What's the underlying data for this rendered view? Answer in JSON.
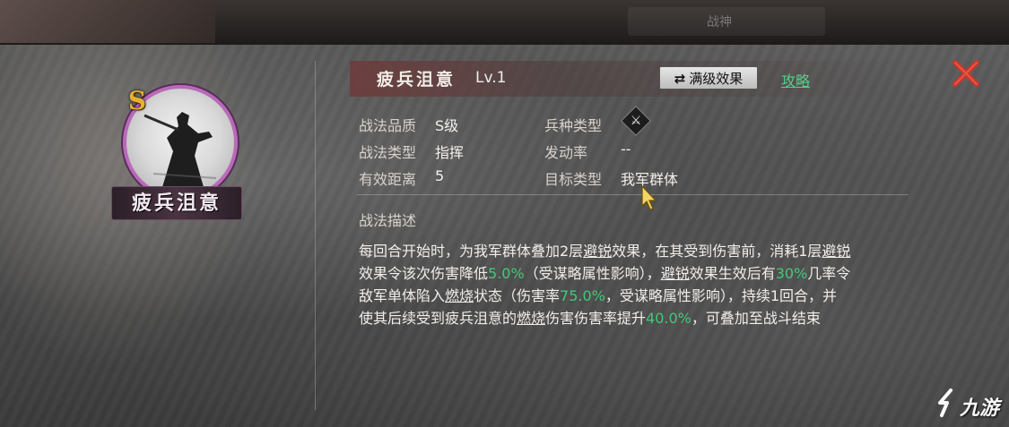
{
  "topbar": {
    "mid_text": "战神"
  },
  "hero": {
    "grade": "S",
    "name": "疲兵沮意"
  },
  "header": {
    "title": "疲兵沮意",
    "level": "Lv.1",
    "max_effect_label": "满级效果",
    "max_effect_icon": "swap-arrows-icon",
    "guide_label": "攻略",
    "close_icon": "close-icon"
  },
  "attributes": {
    "quality": {
      "key": "战法品质",
      "value": "S级"
    },
    "type": {
      "key": "战法类型",
      "value": "指挥"
    },
    "range": {
      "key": "有效距离",
      "value": "5"
    },
    "troop": {
      "key": "兵种类型",
      "icon": "crossed-weapons-icon"
    },
    "rate": {
      "key": "发动率",
      "value": "--"
    },
    "target": {
      "key": "目标类型",
      "value": "我军群体"
    }
  },
  "description": {
    "title": "战法描述",
    "l1a": "每回合开始时，为我军群体叠加2层",
    "l1b": "避锐",
    "l1c": "效果，在其受到伤害前，消耗1层",
    "l1d": "避锐",
    "l2a": "效果令该次伤害降低",
    "l2b": "5.0%",
    "l2c": "（受谋略属性影响），",
    "l2d": "避锐",
    "l2e": "效果生效后有",
    "l2f": "30%",
    "l2g": "几率令",
    "l3a": "敌军单体陷入",
    "l3b": "燃烧",
    "l3c": "状态（伤害率",
    "l3d": "75.0%",
    "l3e": "，受谋略属性影响），持续1回合，并",
    "l4a": "使其后续受到疲兵沮意的",
    "l4b": "燃烧",
    "l4c": "伤害伤害率提升",
    "l4d": "40.0%",
    "l4e": "，可叠加至战斗结束"
  },
  "watermark": {
    "text": "九游"
  },
  "colors": {
    "highlight": "#45c77a",
    "close": "#d23a2f",
    "frame": "#b86ab8",
    "grade": "#e6b12f"
  }
}
